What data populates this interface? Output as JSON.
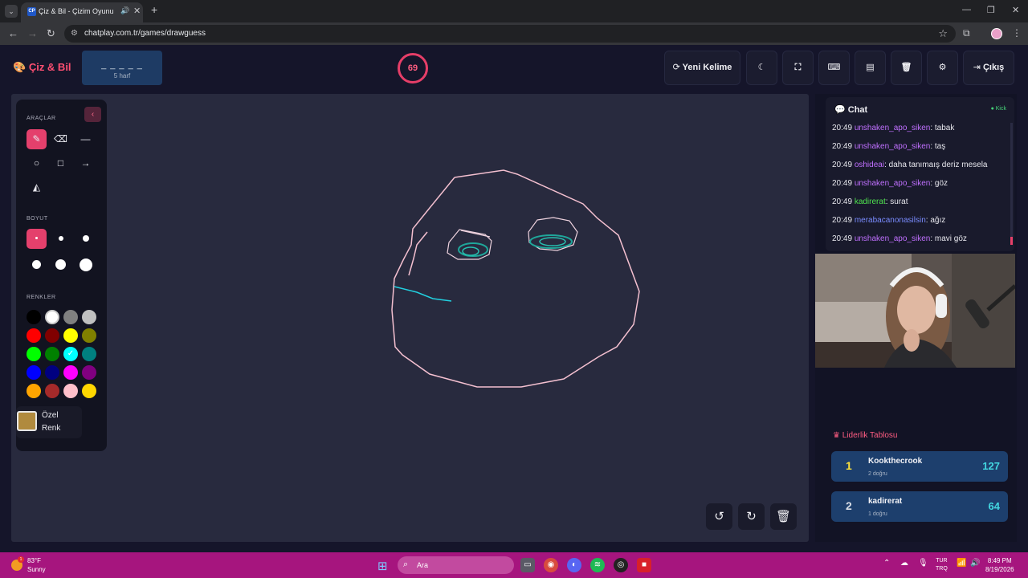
{
  "browser": {
    "tab_title": "Çiz & Bil - Çizim Oyunu",
    "tab_favicon_text": "CP",
    "url": "chatplay.com.tr/games/drawguess"
  },
  "header": {
    "logo": "Çiz & Bil",
    "word_blanks": "_ _ _ _ _",
    "word_length": "5 harf",
    "timer": "69",
    "new_word": "Yeni Kelime",
    "exit": "Çıkış"
  },
  "tools": {
    "section_tools": "ARAÇLAR",
    "section_size": "BOYUT",
    "section_colors": "RENKLER",
    "colors": [
      "#000000",
      "#ffffff",
      "#808080",
      "#c0c0c0",
      "#ff0000",
      "#800000",
      "#ffff00",
      "#808000",
      "#00ff00",
      "#008000",
      "#00ffff",
      "#008080",
      "#0000ff",
      "#000080",
      "#ff00ff",
      "#800080",
      "#ffa500",
      "#a52a2a",
      "#ffc0cb",
      "#ffd700"
    ],
    "custom_color": "#b08a3e",
    "custom_label": "Özel Renk"
  },
  "chat": {
    "title": "Chat",
    "status": "Kick",
    "messages": [
      {
        "time": "20:49",
        "user": "unshaken_apo_siken",
        "color": "#c070ff",
        "text": ": tabak"
      },
      {
        "time": "20:49",
        "user": "unshaken_apo_siken",
        "color": "#c070ff",
        "text": ": taş"
      },
      {
        "time": "20:49",
        "user": "oshideai",
        "color": "#c070ff",
        "text": ": daha tanımaış deriz mesela"
      },
      {
        "time": "20:49",
        "user": "unshaken_apo_siken",
        "color": "#c070ff",
        "text": ": göz"
      },
      {
        "time": "20:49",
        "user": "kadirerat",
        "color": "#4fe34f",
        "text": ": surat"
      },
      {
        "time": "20:49",
        "user": "merabacanonasilsin",
        "color": "#7a8cff",
        "text": ": ağız"
      },
      {
        "time": "20:49",
        "user": "unshaken_apo_siken",
        "color": "#c070ff",
        "text": ": mavi göz"
      }
    ]
  },
  "leaderboard": {
    "title": "Liderlik Tablosu",
    "entries": [
      {
        "rank": "1",
        "rank_color": "#ffe23a",
        "name": "Kookthecrook",
        "sub": "2 doğru",
        "score": "127"
      },
      {
        "rank": "2",
        "rank_color": "#d8dde6",
        "name": "kadirerat",
        "sub": "1 doğru",
        "score": "64"
      }
    ]
  },
  "taskbar": {
    "temperature": "83°F",
    "weather": "Sunny",
    "weather_badge": "1",
    "search": "Ara",
    "lang_top": "TUR",
    "lang_bottom": "TRQ",
    "time": "8:49 PM",
    "date": "8/19/2026"
  }
}
